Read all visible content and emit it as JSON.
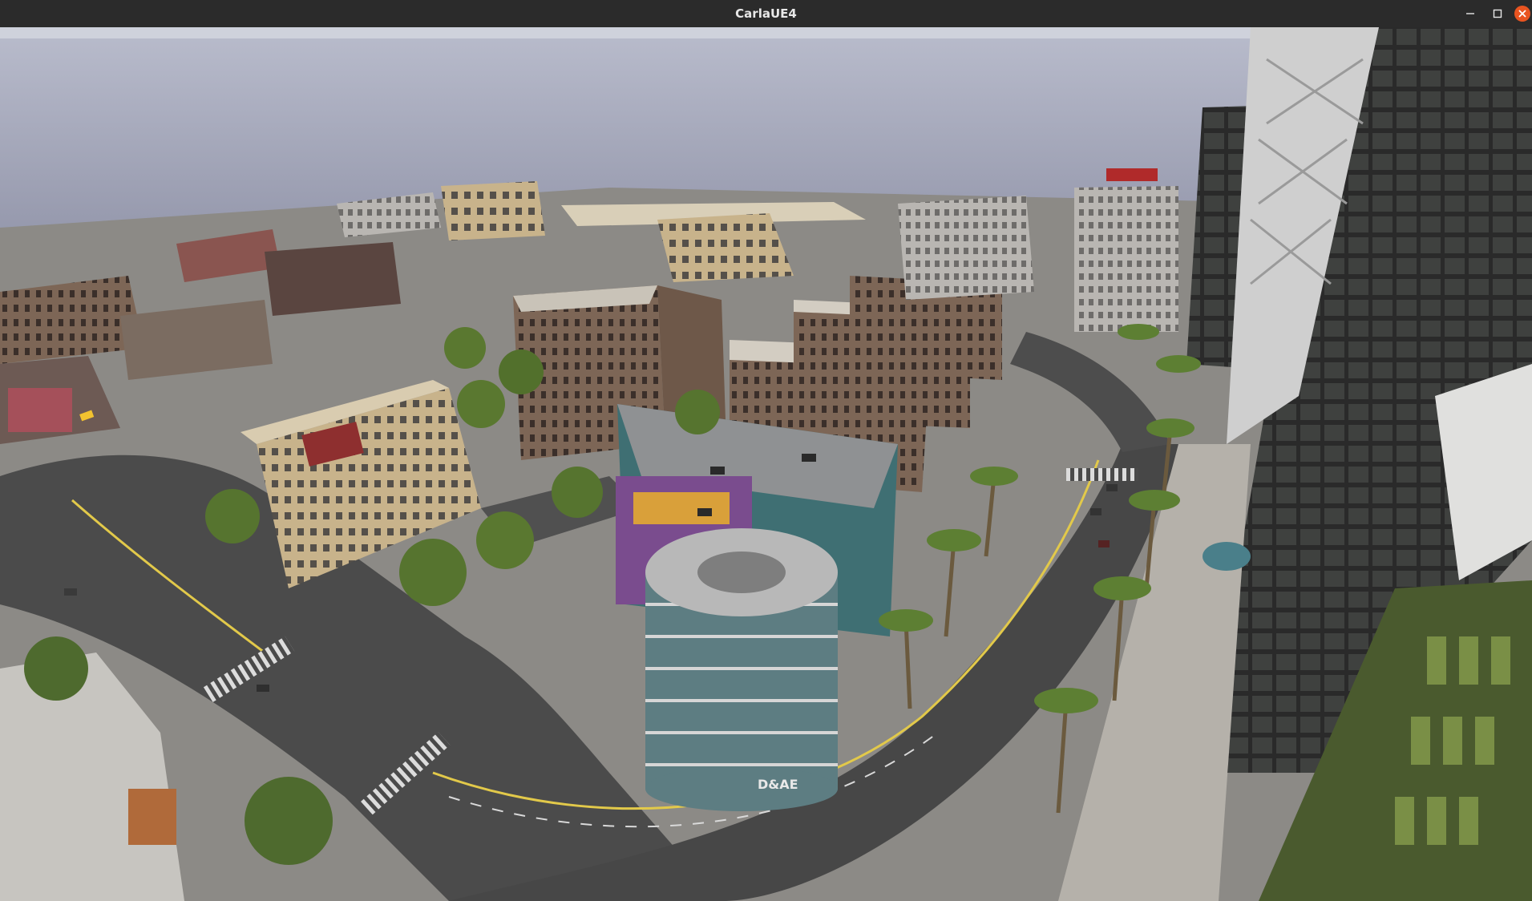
{
  "window": {
    "title": "CarlaUE4",
    "controls": {
      "minimize_icon": "minimize-icon",
      "maximize_icon": "maximize-icon",
      "close_icon": "close-icon"
    },
    "colors": {
      "titlebar": "#2b2b2b",
      "close_button": "#e95420"
    }
  },
  "viewport": {
    "description_icon": "simulation-3d-view",
    "signs": {
      "parking_garage_label": "D&AE"
    }
  }
}
